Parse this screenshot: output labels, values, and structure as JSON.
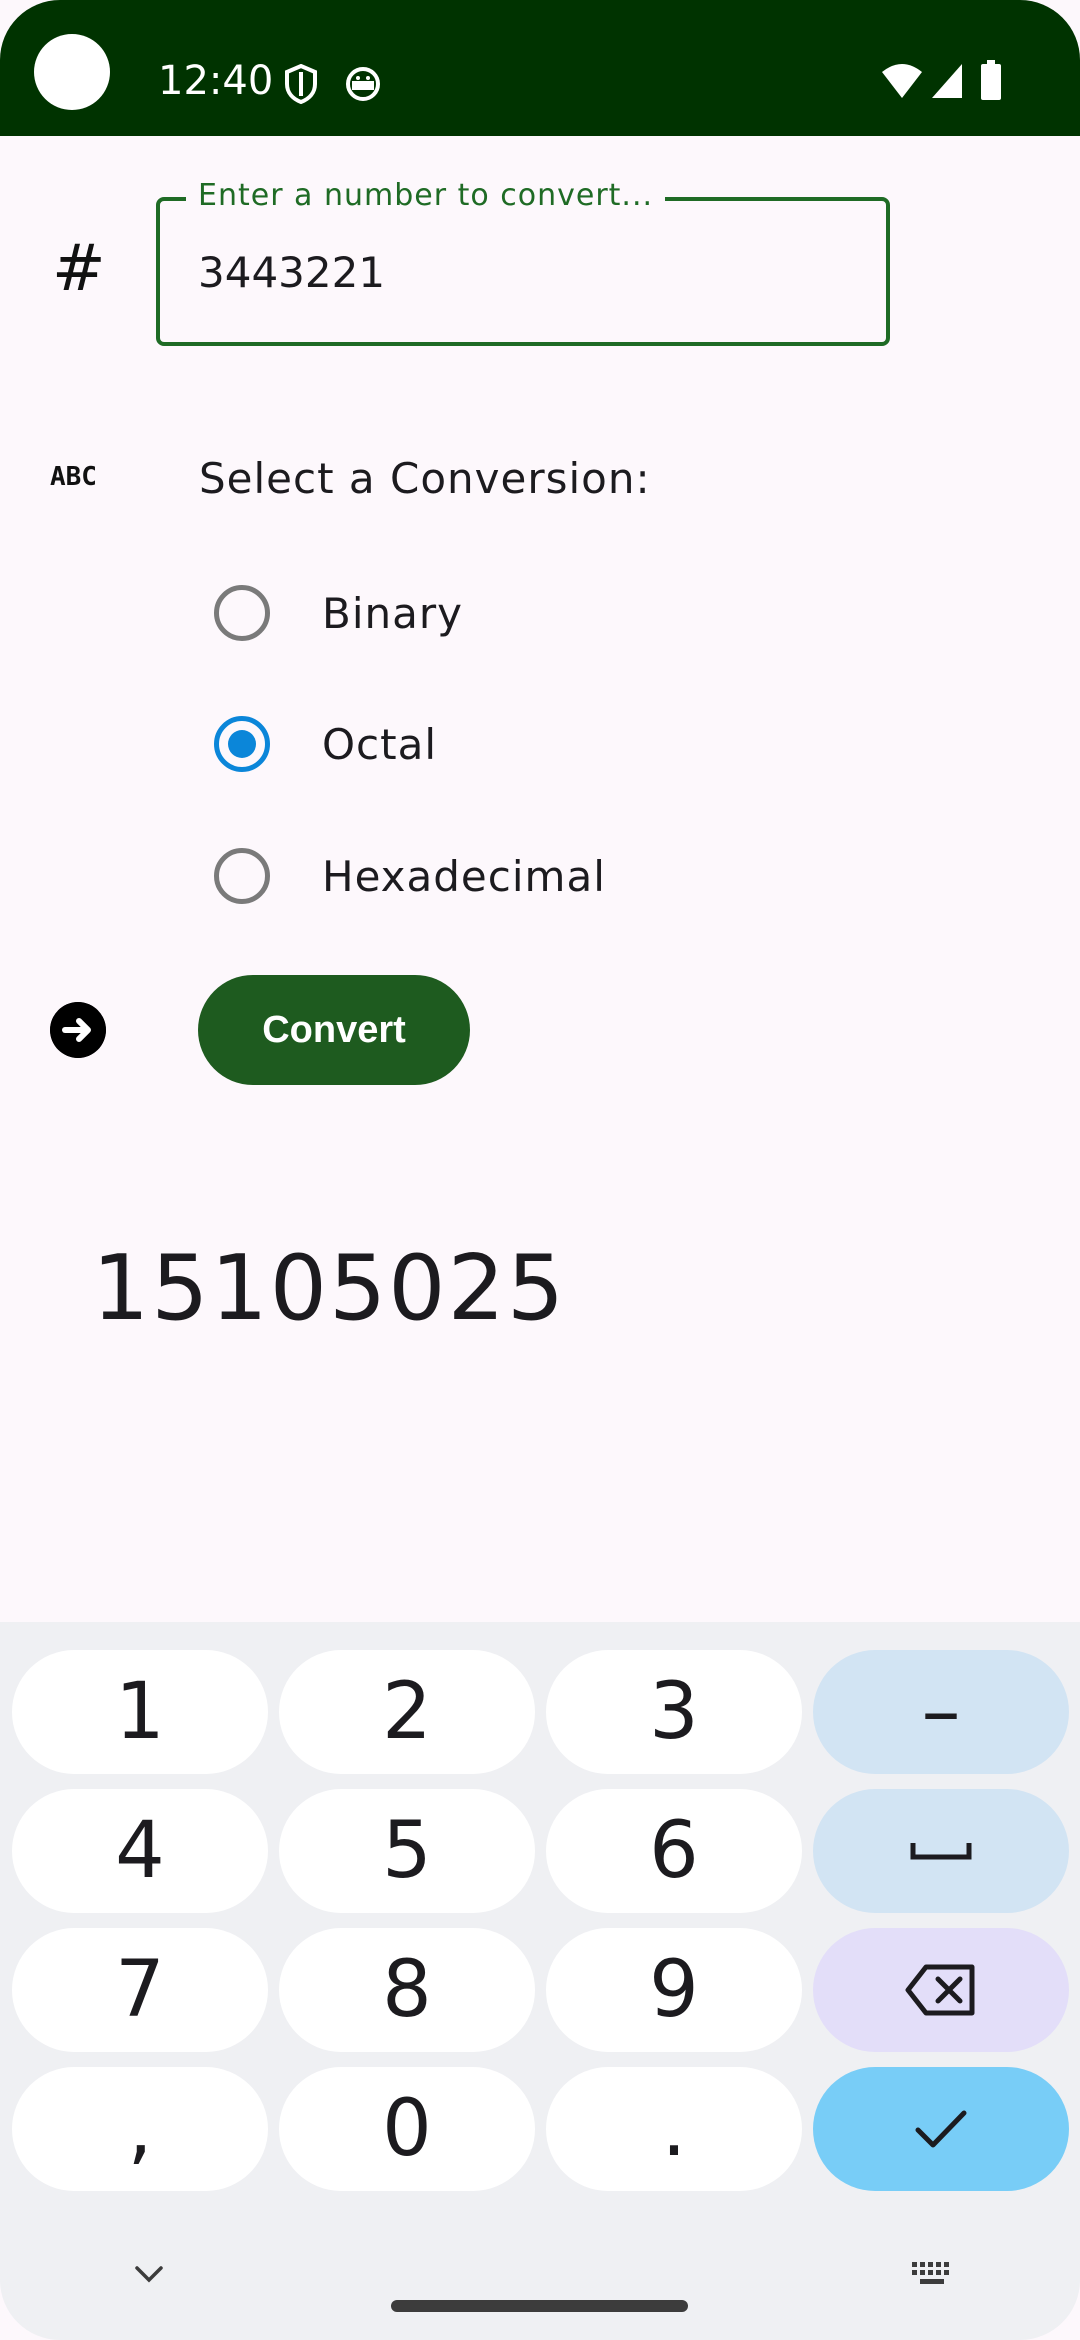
{
  "status_bar": {
    "time": "12:40",
    "icons": [
      "shield-icon",
      "android-debug-icon",
      "wifi-icon",
      "signal-icon",
      "battery-icon"
    ]
  },
  "input": {
    "label": "Enter a number to convert...",
    "value": "3443221",
    "icon": "#"
  },
  "conversion": {
    "icon": "ABC",
    "label": "Select a Conversion:",
    "options": [
      {
        "label": "Binary",
        "checked": false
      },
      {
        "label": "Octal",
        "checked": true
      },
      {
        "label": "Hexadecimal",
        "checked": false
      }
    ]
  },
  "convert_button": {
    "label": "Convert"
  },
  "result": {
    "value": "15105025"
  },
  "keyboard": {
    "keys": [
      "1",
      "2",
      "3",
      "–",
      "4",
      "5",
      "6",
      "space",
      "7",
      "8",
      "9",
      "backspace",
      ",",
      "0",
      ".",
      "enter"
    ],
    "labels": {
      "k1": "1",
      "k2": "2",
      "k3": "3",
      "dash": "–",
      "k4": "4",
      "k5": "5",
      "k6": "6",
      "k7": "7",
      "k8": "8",
      "k9": "9",
      "comma": ",",
      "k0": "0",
      "dot": "."
    }
  },
  "colors": {
    "status_bar": "#003300",
    "accent_green": "#1e5b1f",
    "radio_selected": "#0b86d9",
    "background": "#fdf8fc"
  }
}
